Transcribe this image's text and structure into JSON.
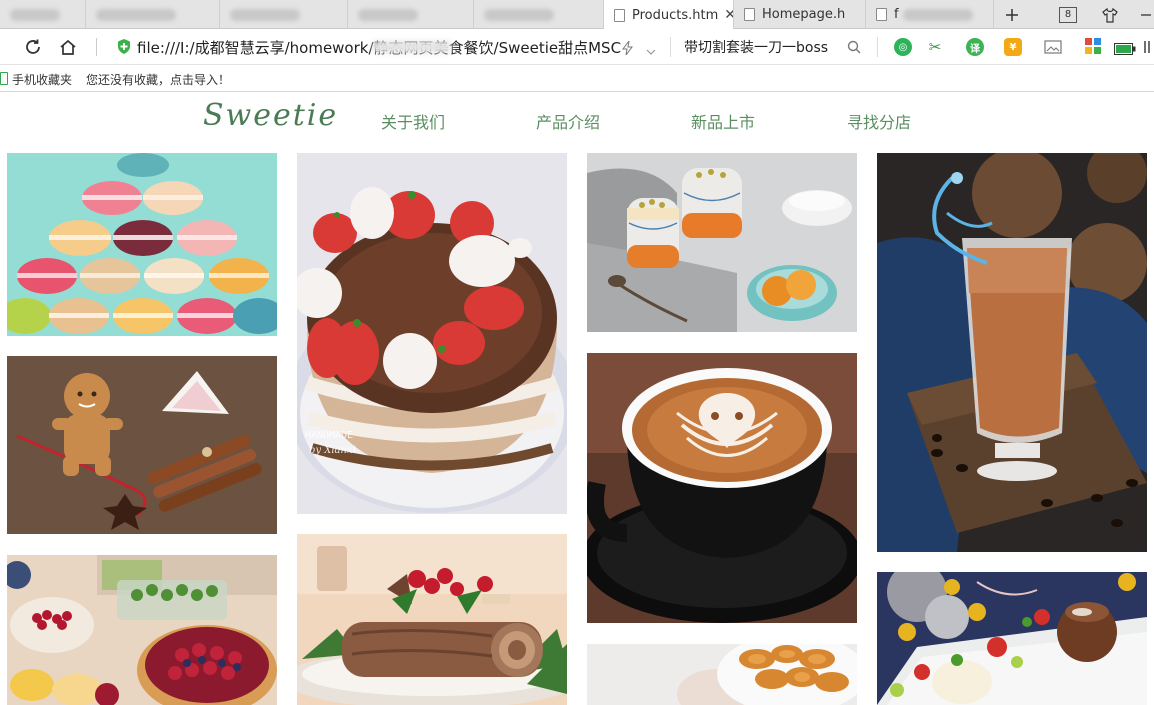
{
  "browser": {
    "tabs": [
      {
        "title": "Products.htm"
      },
      {
        "title": "Homepage.h"
      },
      {
        "title": "f"
      }
    ],
    "tab_count": "8",
    "url": "file:///I:/成都智慧云享/homework/静态网页美食餐饮/Sweetie甜点MSC",
    "search_text": "带切割套装一刀一boss"
  },
  "bookmarks": {
    "mobile": "手机收藏夹",
    "hint": "您还没有收藏，点击导入！"
  },
  "site": {
    "logo": "Sweetie",
    "nav": [
      "关于我们",
      "产品介绍",
      "新品上市",
      "寻找分店"
    ]
  },
  "gallery": {
    "watermark_line1": "HANDMADE",
    "watermark_line2": "by Xianxi"
  },
  "colors": {
    "brand_green": "#4a7b54",
    "nav_green": "#5a8e62"
  }
}
